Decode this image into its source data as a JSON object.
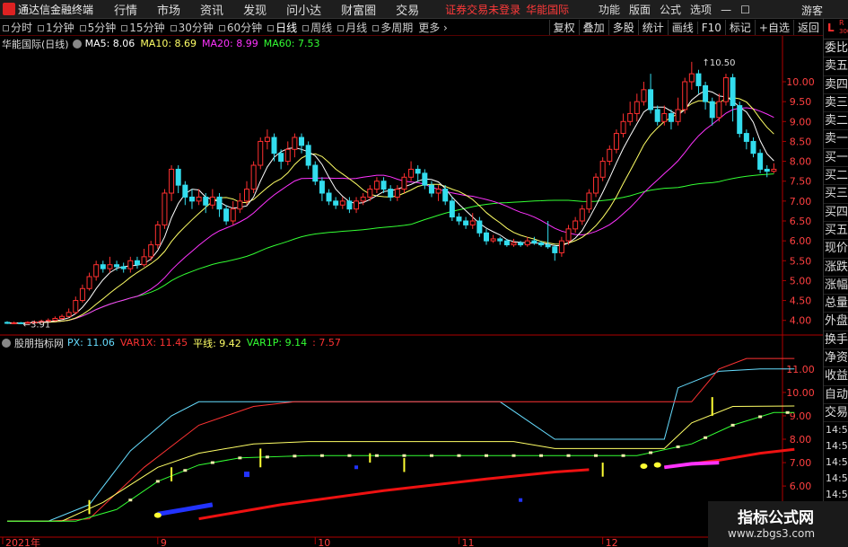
{
  "app": {
    "title": "通达信金融终端",
    "menus": [
      "行情",
      "市场",
      "资讯",
      "发现",
      "问小达",
      "财富圈",
      "交易"
    ],
    "status_text": "证券交易未登录",
    "stock_name": "华能国际",
    "right_menus": [
      "功能",
      "版面",
      "公式",
      "选项"
    ],
    "guest_label": "游客"
  },
  "periods": {
    "items": [
      "分时",
      "1分钟",
      "5分钟",
      "15分钟",
      "30分钟",
      "60分钟",
      "日线",
      "周线",
      "月线",
      "多周期",
      "更多"
    ],
    "active": "日线"
  },
  "tools": [
    "复权",
    "叠加",
    "多股",
    "统计",
    "画线",
    "F10",
    "标记",
    "+自选",
    "返回"
  ],
  "main_header": {
    "title": "华能国际(日线)",
    "ma": [
      {
        "label": "MA5: 8.06",
        "color": "#ffffff"
      },
      {
        "label": "MA10: 8.69",
        "color": "#ffff66"
      },
      {
        "label": "MA20: 8.99",
        "color": "#ff33ff"
      },
      {
        "label": "MA60: 7.53",
        "color": "#33ff33"
      }
    ]
  },
  "indicator_header": {
    "title": "股朋指标网",
    "values": [
      {
        "label": "PX: 11.06",
        "color": "#66ddff"
      },
      {
        "label": "VAR1X: 11.45",
        "color": "#ff3333"
      },
      {
        "label": "平线: 9.42",
        "color": "#ffff66"
      },
      {
        "label": "VAR1P: 9.14",
        "color": "#33ff33"
      },
      {
        "label": ": 7.57",
        "color": "#ff3333"
      }
    ]
  },
  "chart_data": {
    "type": "candlestick",
    "price_axis": {
      "ticks": [
        "10.00",
        "9.50",
        "9.00",
        "8.50",
        "8.00",
        "7.50",
        "7.00",
        "6.50",
        "6.00",
        "5.50",
        "5.00",
        "4.50",
        "4.00"
      ]
    },
    "indicator_axis": {
      "ticks": [
        "11.00",
        "10.00",
        "9.00",
        "8.00",
        "7.00",
        "6.00",
        "5.00"
      ]
    },
    "annotations": {
      "high": "10.50",
      "low": "3.91"
    },
    "x_labels": [
      "2021年",
      "9",
      "10",
      "11",
      "12"
    ],
    "candles": [
      [
        3.95,
        3.93,
        3.98,
        3.91
      ],
      [
        3.93,
        3.94,
        3.97,
        3.91
      ],
      [
        3.94,
        3.93,
        3.96,
        3.92
      ],
      [
        3.93,
        3.95,
        3.98,
        3.92
      ],
      [
        3.95,
        3.96,
        4.0,
        3.93
      ],
      [
        3.96,
        3.98,
        4.02,
        3.94
      ],
      [
        3.98,
        4.0,
        4.05,
        3.96
      ],
      [
        4.0,
        4.05,
        4.1,
        3.98
      ],
      [
        4.05,
        4.1,
        4.15,
        4.02
      ],
      [
        4.1,
        4.2,
        4.3,
        4.08
      ],
      [
        4.2,
        4.5,
        4.6,
        4.15
      ],
      [
        4.5,
        4.8,
        4.9,
        4.45
      ],
      [
        4.8,
        5.1,
        5.2,
        4.75
      ],
      [
        5.1,
        5.4,
        5.5,
        5.0
      ],
      [
        5.4,
        5.3,
        5.5,
        5.2
      ],
      [
        5.3,
        5.4,
        5.6,
        5.2
      ],
      [
        5.4,
        5.35,
        5.5,
        5.25
      ],
      [
        5.35,
        5.3,
        5.45,
        5.2
      ],
      [
        5.3,
        5.5,
        5.6,
        5.2
      ],
      [
        5.5,
        5.4,
        5.6,
        5.3
      ],
      [
        5.4,
        5.6,
        5.8,
        5.35
      ],
      [
        5.6,
        5.9,
        6.0,
        5.5
      ],
      [
        5.9,
        6.4,
        6.5,
        5.8
      ],
      [
        6.4,
        7.2,
        7.3,
        6.3
      ],
      [
        7.2,
        7.8,
        7.9,
        7.0
      ],
      [
        7.8,
        7.4,
        7.9,
        7.2
      ],
      [
        7.4,
        7.1,
        7.5,
        6.9
      ],
      [
        7.1,
        7.0,
        7.3,
        6.8
      ],
      [
        7.0,
        7.1,
        7.3,
        6.9
      ],
      [
        7.1,
        6.9,
        7.2,
        6.7
      ],
      [
        6.9,
        7.1,
        7.3,
        6.8
      ],
      [
        7.1,
        6.8,
        7.2,
        6.6
      ],
      [
        6.8,
        6.5,
        6.9,
        6.4
      ],
      [
        6.5,
        6.8,
        7.0,
        6.4
      ],
      [
        6.8,
        7.0,
        7.2,
        6.7
      ],
      [
        7.0,
        7.3,
        7.5,
        6.9
      ],
      [
        7.3,
        7.9,
        8.0,
        7.2
      ],
      [
        7.9,
        8.5,
        8.6,
        7.8
      ],
      [
        8.5,
        8.6,
        8.8,
        8.3
      ],
      [
        8.6,
        8.2,
        8.7,
        8.0
      ],
      [
        8.2,
        8.0,
        8.3,
        7.8
      ],
      [
        8.0,
        8.3,
        8.5,
        7.9
      ],
      [
        8.3,
        8.6,
        8.7,
        8.1
      ],
      [
        8.6,
        8.4,
        8.7,
        8.2
      ],
      [
        8.4,
        7.9,
        8.5,
        7.8
      ],
      [
        7.9,
        7.5,
        8.0,
        7.4
      ],
      [
        7.5,
        7.2,
        7.6,
        7.0
      ],
      [
        7.2,
        7.0,
        7.3,
        6.9
      ],
      [
        7.0,
        6.9,
        7.1,
        6.8
      ],
      [
        6.9,
        7.0,
        7.1,
        6.8
      ],
      [
        7.0,
        6.8,
        7.1,
        6.7
      ],
      [
        6.8,
        7.0,
        7.1,
        6.7
      ],
      [
        7.0,
        7.1,
        7.2,
        6.9
      ],
      [
        7.1,
        7.3,
        7.4,
        7.0
      ],
      [
        7.3,
        7.5,
        7.6,
        7.2
      ],
      [
        7.5,
        7.3,
        7.6,
        7.2
      ],
      [
        7.3,
        7.1,
        7.4,
        7.0
      ],
      [
        7.1,
        7.3,
        7.4,
        7.0
      ],
      [
        7.3,
        7.6,
        7.7,
        7.2
      ],
      [
        7.6,
        7.8,
        8.0,
        7.5
      ],
      [
        7.8,
        7.7,
        7.9,
        7.5
      ],
      [
        7.7,
        7.4,
        7.8,
        7.3
      ],
      [
        7.4,
        7.2,
        7.5,
        7.1
      ],
      [
        7.2,
        7.3,
        7.4,
        7.0
      ],
      [
        7.3,
        7.0,
        7.4,
        6.9
      ],
      [
        7.0,
        6.6,
        7.1,
        6.5
      ],
      [
        6.6,
        6.5,
        6.7,
        6.4
      ],
      [
        6.5,
        6.4,
        6.6,
        6.3
      ],
      [
        6.4,
        6.5,
        6.7,
        6.3
      ],
      [
        6.5,
        6.2,
        6.6,
        6.1
      ],
      [
        6.2,
        6.0,
        6.3,
        5.9
      ],
      [
        6.0,
        6.05,
        6.15,
        5.95
      ],
      [
        6.05,
        6.0,
        6.1,
        5.9
      ],
      [
        6.0,
        5.9,
        6.05,
        5.85
      ],
      [
        5.9,
        5.95,
        6.05,
        5.85
      ],
      [
        5.95,
        5.9,
        6.0,
        5.85
      ],
      [
        5.9,
        6.0,
        6.1,
        5.85
      ],
      [
        6.0,
        5.95,
        6.1,
        5.9
      ],
      [
        5.95,
        5.9,
        6.0,
        5.85
      ],
      [
        5.9,
        5.85,
        6.5,
        5.8
      ],
      [
        5.85,
        5.7,
        5.9,
        5.5
      ],
      [
        5.7,
        6.0,
        6.1,
        5.6
      ],
      [
        6.0,
        6.3,
        6.4,
        5.9
      ],
      [
        6.3,
        6.5,
        6.6,
        6.2
      ],
      [
        6.5,
        6.8,
        6.9,
        6.4
      ],
      [
        6.8,
        7.2,
        7.3,
        6.7
      ],
      [
        7.2,
        7.6,
        7.7,
        7.1
      ],
      [
        7.6,
        8.0,
        8.1,
        7.5
      ],
      [
        8.0,
        8.3,
        8.4,
        7.9
      ],
      [
        8.3,
        8.7,
        8.8,
        8.2
      ],
      [
        8.7,
        9.0,
        9.2,
        8.6
      ],
      [
        9.0,
        9.2,
        9.5,
        8.9
      ],
      [
        9.2,
        9.5,
        9.7,
        9.0
      ],
      [
        9.5,
        9.8,
        10.0,
        9.4
      ],
      [
        9.8,
        9.3,
        10.2,
        9.2
      ],
      [
        9.3,
        9.0,
        9.4,
        8.9
      ],
      [
        9.0,
        9.2,
        9.4,
        8.9
      ],
      [
        9.2,
        9.0,
        9.3,
        8.8
      ],
      [
        9.0,
        9.3,
        9.6,
        8.9
      ],
      [
        9.3,
        10.0,
        10.1,
        9.2
      ],
      [
        10.0,
        10.2,
        10.5,
        9.8
      ],
      [
        10.2,
        9.9,
        10.3,
        9.7
      ],
      [
        9.9,
        9.5,
        10.0,
        9.3
      ],
      [
        9.5,
        9.1,
        9.6,
        8.9
      ],
      [
        9.1,
        9.5,
        9.7,
        9.0
      ],
      [
        9.5,
        10.1,
        10.2,
        9.4
      ],
      [
        10.1,
        9.4,
        10.2,
        9.0
      ],
      [
        9.4,
        8.7,
        9.5,
        8.6
      ],
      [
        8.7,
        8.5,
        8.8,
        8.3
      ],
      [
        8.5,
        8.2,
        8.6,
        8.1
      ],
      [
        8.2,
        7.8,
        8.3,
        7.7
      ],
      [
        7.8,
        7.75,
        7.9,
        7.6
      ],
      [
        7.75,
        7.8,
        7.95,
        7.7
      ]
    ]
  }
}
